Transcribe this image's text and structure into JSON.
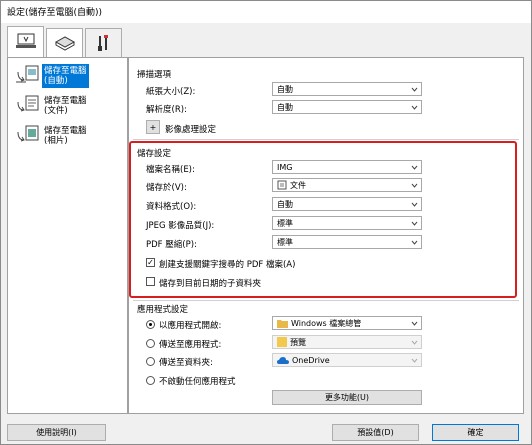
{
  "window": {
    "title": "設定(儲存至電腦(自動))"
  },
  "tabs": [
    {
      "name": "scan-to-pc-tab",
      "icon": "computer-scan-icon"
    },
    {
      "name": "scanner-tab",
      "icon": "scanner-icon"
    },
    {
      "name": "tools-tab",
      "icon": "tools-icon"
    }
  ],
  "left_list": [
    {
      "label": "儲存至電腦\n(自動)",
      "icon": "auto-save-icon",
      "selected": true
    },
    {
      "label": "儲存至電腦\n(文件)",
      "icon": "document-save-icon",
      "selected": false
    },
    {
      "label": "儲存至電腦\n(相片)",
      "icon": "photo-save-icon",
      "selected": false
    }
  ],
  "scan_options": {
    "title": "掃描選項",
    "paper_size": {
      "label": "紙張大小(Z):",
      "value": "自動"
    },
    "resolution": {
      "label": "解析度(R):",
      "value": "自動"
    },
    "image_processing": {
      "label": "影像處理設定",
      "expander": "+"
    }
  },
  "save_settings": {
    "title": "儲存設定",
    "file_name": {
      "label": "檔案名稱(E):",
      "value": "IMG"
    },
    "save_in": {
      "label": "儲存於(V):",
      "value": "文件"
    },
    "data_format": {
      "label": "資料格式(O):",
      "value": "自動"
    },
    "jpeg_quality": {
      "label": "JPEG 影像品質(J):",
      "value": "標準"
    },
    "pdf_compression": {
      "label": "PDF 壓縮(P):",
      "value": "標準"
    },
    "searchable_pdf": {
      "label": "創建支援關鍵字搜尋的 PDF 檔案(A)",
      "checked": true
    },
    "date_subfolder": {
      "label": "儲存到目前日期的子資料夾",
      "checked": false
    }
  },
  "app_settings": {
    "title": "應用程式設定",
    "options": [
      {
        "label": "以應用程式開啟:",
        "value": "Windows 檔案總管",
        "selected": true,
        "enabled": true
      },
      {
        "label": "傳送至應用程式:",
        "value": "預覽",
        "selected": false,
        "enabled": false
      },
      {
        "label": "傳送至資料夾:",
        "value": "OneDrive",
        "selected": false,
        "enabled": false
      },
      {
        "label": "不啟動任何應用程式",
        "value": "",
        "selected": false,
        "enabled": false
      }
    ],
    "more_functions": "更多功能(U)"
  },
  "footer": {
    "instructions": "使用說明(I)",
    "defaults": "預設值(D)",
    "ok": "確定"
  }
}
